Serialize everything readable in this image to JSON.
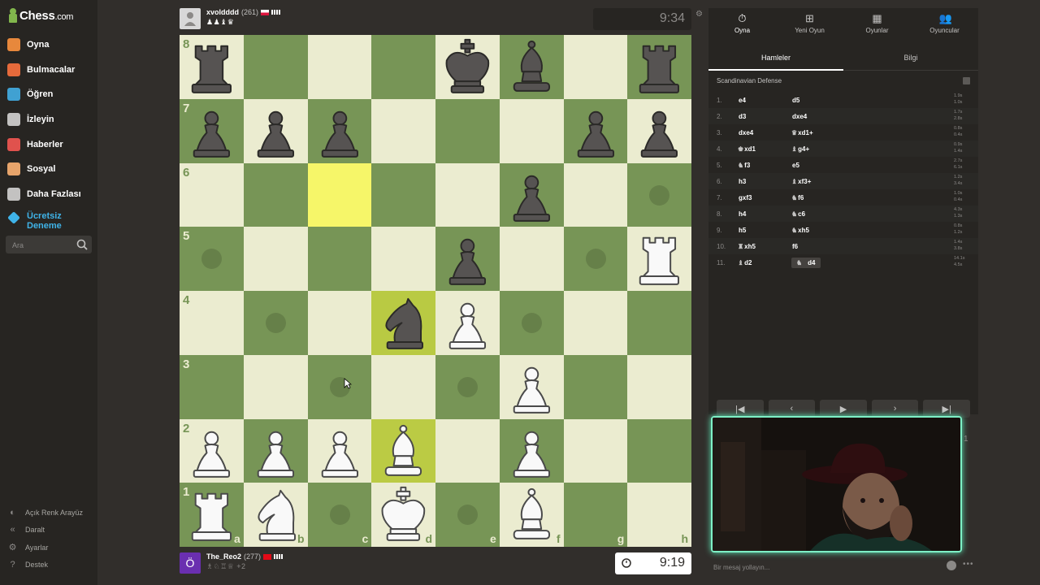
{
  "brand": {
    "name": "Chess",
    "suffix": ".com"
  },
  "nav": [
    {
      "label": "Oyna",
      "icon": "play-icon",
      "color": "#e7883c"
    },
    {
      "label": "Bulmacalar",
      "icon": "puzzle-icon",
      "color": "#e66a3b"
    },
    {
      "label": "Öğren",
      "icon": "learn-icon",
      "color": "#40a1d2"
    },
    {
      "label": "İzleyin",
      "icon": "binoculars-icon",
      "color": "#c3c2c1"
    },
    {
      "label": "Haberler",
      "icon": "news-icon",
      "color": "#e0524d"
    },
    {
      "label": "Sosyal",
      "icon": "social-icon",
      "color": "#e7a46b"
    },
    {
      "label": "Daha Fazlası",
      "icon": "more-icon",
      "color": "#c3c2c1"
    }
  ],
  "premium": {
    "label": "Ücretsiz Deneme"
  },
  "search": {
    "placeholder": "Ara"
  },
  "bottom_nav": [
    {
      "label": "Açık Renk Arayüz",
      "icon": "theme-icon"
    },
    {
      "label": "Daralt",
      "icon": "collapse-icon"
    },
    {
      "label": "Ayarlar",
      "icon": "settings-icon"
    },
    {
      "label": "Destek",
      "icon": "help-icon"
    }
  ],
  "top_player": {
    "name": "xvoldddd",
    "rating": "(261)",
    "clock": "9:34",
    "flag": "poland",
    "captured": "♟♟♝♛"
  },
  "bottom_player": {
    "name": "The_Reo2",
    "rating": "(277)",
    "clock": "9:19",
    "avatar_letter": "Ö",
    "flag": "turkey",
    "captured": "♗♘♖♕",
    "material": "+2"
  },
  "board": {
    "files": [
      "a",
      "b",
      "c",
      "d",
      "e",
      "f",
      "g",
      "h"
    ],
    "ranks": [
      "8",
      "7",
      "6",
      "5",
      "4",
      "3",
      "2",
      "1"
    ],
    "pieces": {
      "a8": "bR",
      "e8": "bK",
      "f8": "bB",
      "h8": "bR",
      "a7": "bP",
      "b7": "bP",
      "c7": "bP",
      "g7": "bP",
      "h7": "bP",
      "f6": "bP",
      "e5": "bP",
      "h5": "wR",
      "d4": "bN",
      "e4": "wP",
      "f3": "wP",
      "a2": "wP",
      "b2": "wP",
      "c2": "wP",
      "d2": "wB",
      "f2": "wP",
      "a1": "wR",
      "b1": "wN",
      "d1": "wK",
      "f1": "wB"
    },
    "highlight_yellow": [
      "c6"
    ],
    "highlight_move": [
      "d4",
      "d2"
    ],
    "dots": [
      "h6",
      "a5",
      "g5",
      "b4",
      "f4",
      "c3",
      "e3",
      "c1",
      "e1"
    ],
    "cursor_square": "c3"
  },
  "panel": {
    "tabs": [
      {
        "label": "Oyna",
        "icon": "stopwatch-icon",
        "active": true
      },
      {
        "label": "Yeni Oyun",
        "icon": "plus-icon",
        "active": false
      },
      {
        "label": "Oyunlar",
        "icon": "board-icon",
        "active": false
      },
      {
        "label": "Oyuncular",
        "icon": "players-icon",
        "active": false
      }
    ],
    "subtabs": [
      {
        "label": "Hamleler",
        "active": true
      },
      {
        "label": "Bilgi",
        "active": false
      }
    ],
    "opening": "Scandinavian Defense",
    "moves": [
      {
        "n": "1.",
        "w": "e4",
        "wp": "",
        "b": "d5",
        "bp": "",
        "tw": "1.9s",
        "tb": "1.0s"
      },
      {
        "n": "2.",
        "w": "d3",
        "wp": "",
        "b": "dxe4",
        "bp": "",
        "tw": "1.7s",
        "tb": "2.8s"
      },
      {
        "n": "3.",
        "w": "dxe4",
        "wp": "",
        "b": "xd1+",
        "bp": "♛",
        "tw": "0.8s",
        "tb": "0.4s"
      },
      {
        "n": "4.",
        "w": "xd1",
        "wp": "♚",
        "b": "g4+",
        "bp": "♝",
        "tw": "0.9s",
        "tb": "1.4s"
      },
      {
        "n": "5.",
        "w": "f3",
        "wp": "♞",
        "b": "e5",
        "bp": "",
        "tw": "2.7s",
        "tb": "6.1s"
      },
      {
        "n": "6.",
        "w": "h3",
        "wp": "",
        "b": "xf3+",
        "bp": "♝",
        "tw": "1.2s",
        "tb": "3.4s"
      },
      {
        "n": "7.",
        "w": "gxf3",
        "wp": "",
        "b": "f6",
        "bp": "♞",
        "tw": "1.0s",
        "tb": "0.4s"
      },
      {
        "n": "8.",
        "w": "h4",
        "wp": "",
        "b": "c6",
        "bp": "♞",
        "tw": "4.3s",
        "tb": "1.3s"
      },
      {
        "n": "9.",
        "w": "h5",
        "wp": "",
        "b": "xh5",
        "bp": "♞",
        "tw": "0.8s",
        "tb": "1.2s"
      },
      {
        "n": "10.",
        "w": "xh5",
        "wp": "♜",
        "b": "f6",
        "bp": "",
        "tw": "1.4s",
        "tb": "3.8s"
      },
      {
        "n": "11.",
        "w": "d2",
        "wp": "♝",
        "b": "d4",
        "bp": "♞",
        "tw": "14.1s",
        "tb": "4.5s"
      }
    ],
    "controls": [
      "first",
      "prev",
      "play",
      "next",
      "last"
    ]
  },
  "webcam": {
    "counter": "1"
  },
  "chat": {
    "placeholder": "Bir mesaj yollayın..."
  },
  "colors": {
    "light": "#ebecd0",
    "dark": "#779556",
    "highlight": "#f6f669",
    "accent": "#81b64c",
    "webcam_border": "#7ef0c6"
  }
}
